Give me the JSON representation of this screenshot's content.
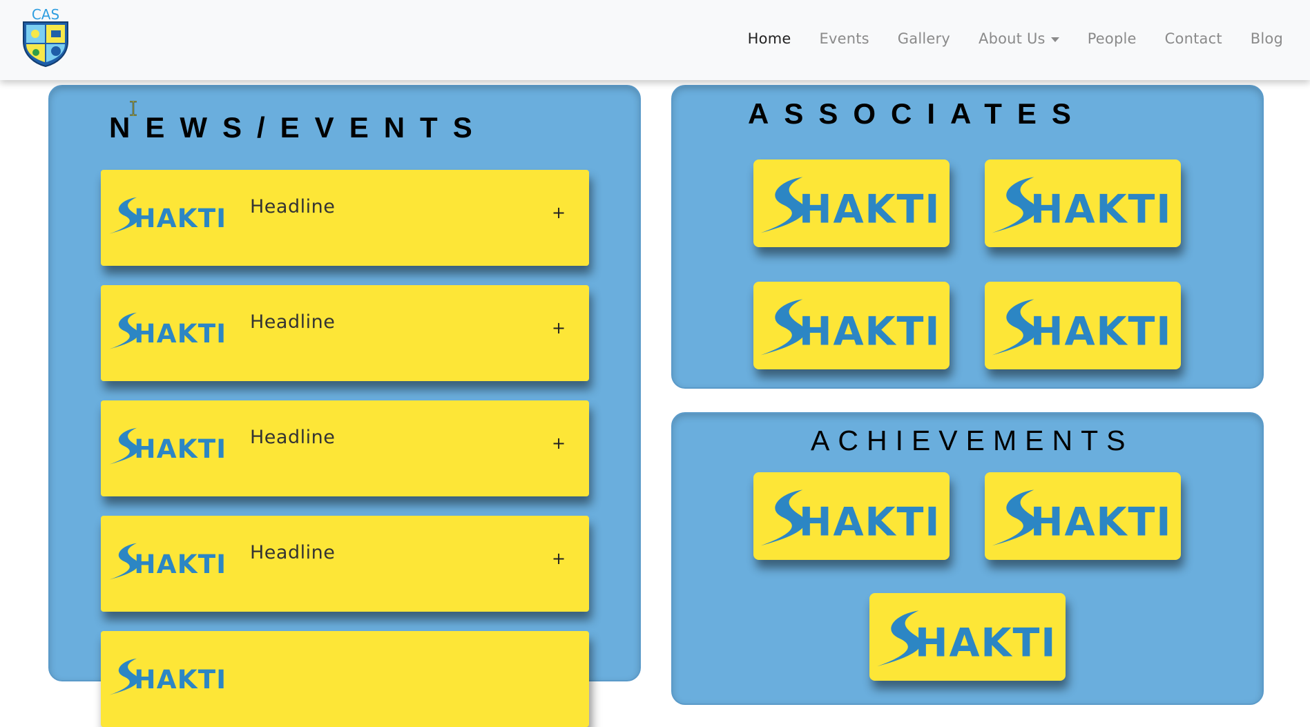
{
  "site": {
    "logo_text": "CAS",
    "logo_icon": "crest-logo-icon"
  },
  "nav": {
    "items": [
      {
        "label": "Home",
        "active": true
      },
      {
        "label": "Events"
      },
      {
        "label": "Gallery"
      },
      {
        "label": "About Us",
        "dropdown": true
      },
      {
        "label": "People"
      },
      {
        "label": "Contact"
      },
      {
        "label": "Blog"
      }
    ]
  },
  "news": {
    "title": "NEWS/EVENTS",
    "cards": [
      {
        "logo_text": "SHAKTI",
        "headline": "Headline",
        "expand": "+"
      },
      {
        "logo_text": "SHAKTI",
        "headline": "Headline",
        "expand": "+"
      },
      {
        "logo_text": "SHAKTI",
        "headline": "Headline",
        "expand": "+"
      },
      {
        "logo_text": "SHAKTI",
        "headline": "Headline",
        "expand": "+"
      },
      {
        "logo_text": "SHAKTI",
        "headline": "",
        "expand": ""
      }
    ]
  },
  "associates": {
    "title": "ASSOCIATES",
    "logos": [
      "SHAKTI",
      "SHAKTI",
      "SHAKTI",
      "SHAKTI"
    ]
  },
  "achievements": {
    "title": "ACHIEVEMENTS",
    "logos": [
      "SHAKTI",
      "SHAKTI",
      "SHAKTI"
    ]
  },
  "colors": {
    "panel": "#6aaedd",
    "card": "#fde637",
    "brand_blue": "#2c86c4",
    "nav_bg": "#f8f9fa"
  }
}
